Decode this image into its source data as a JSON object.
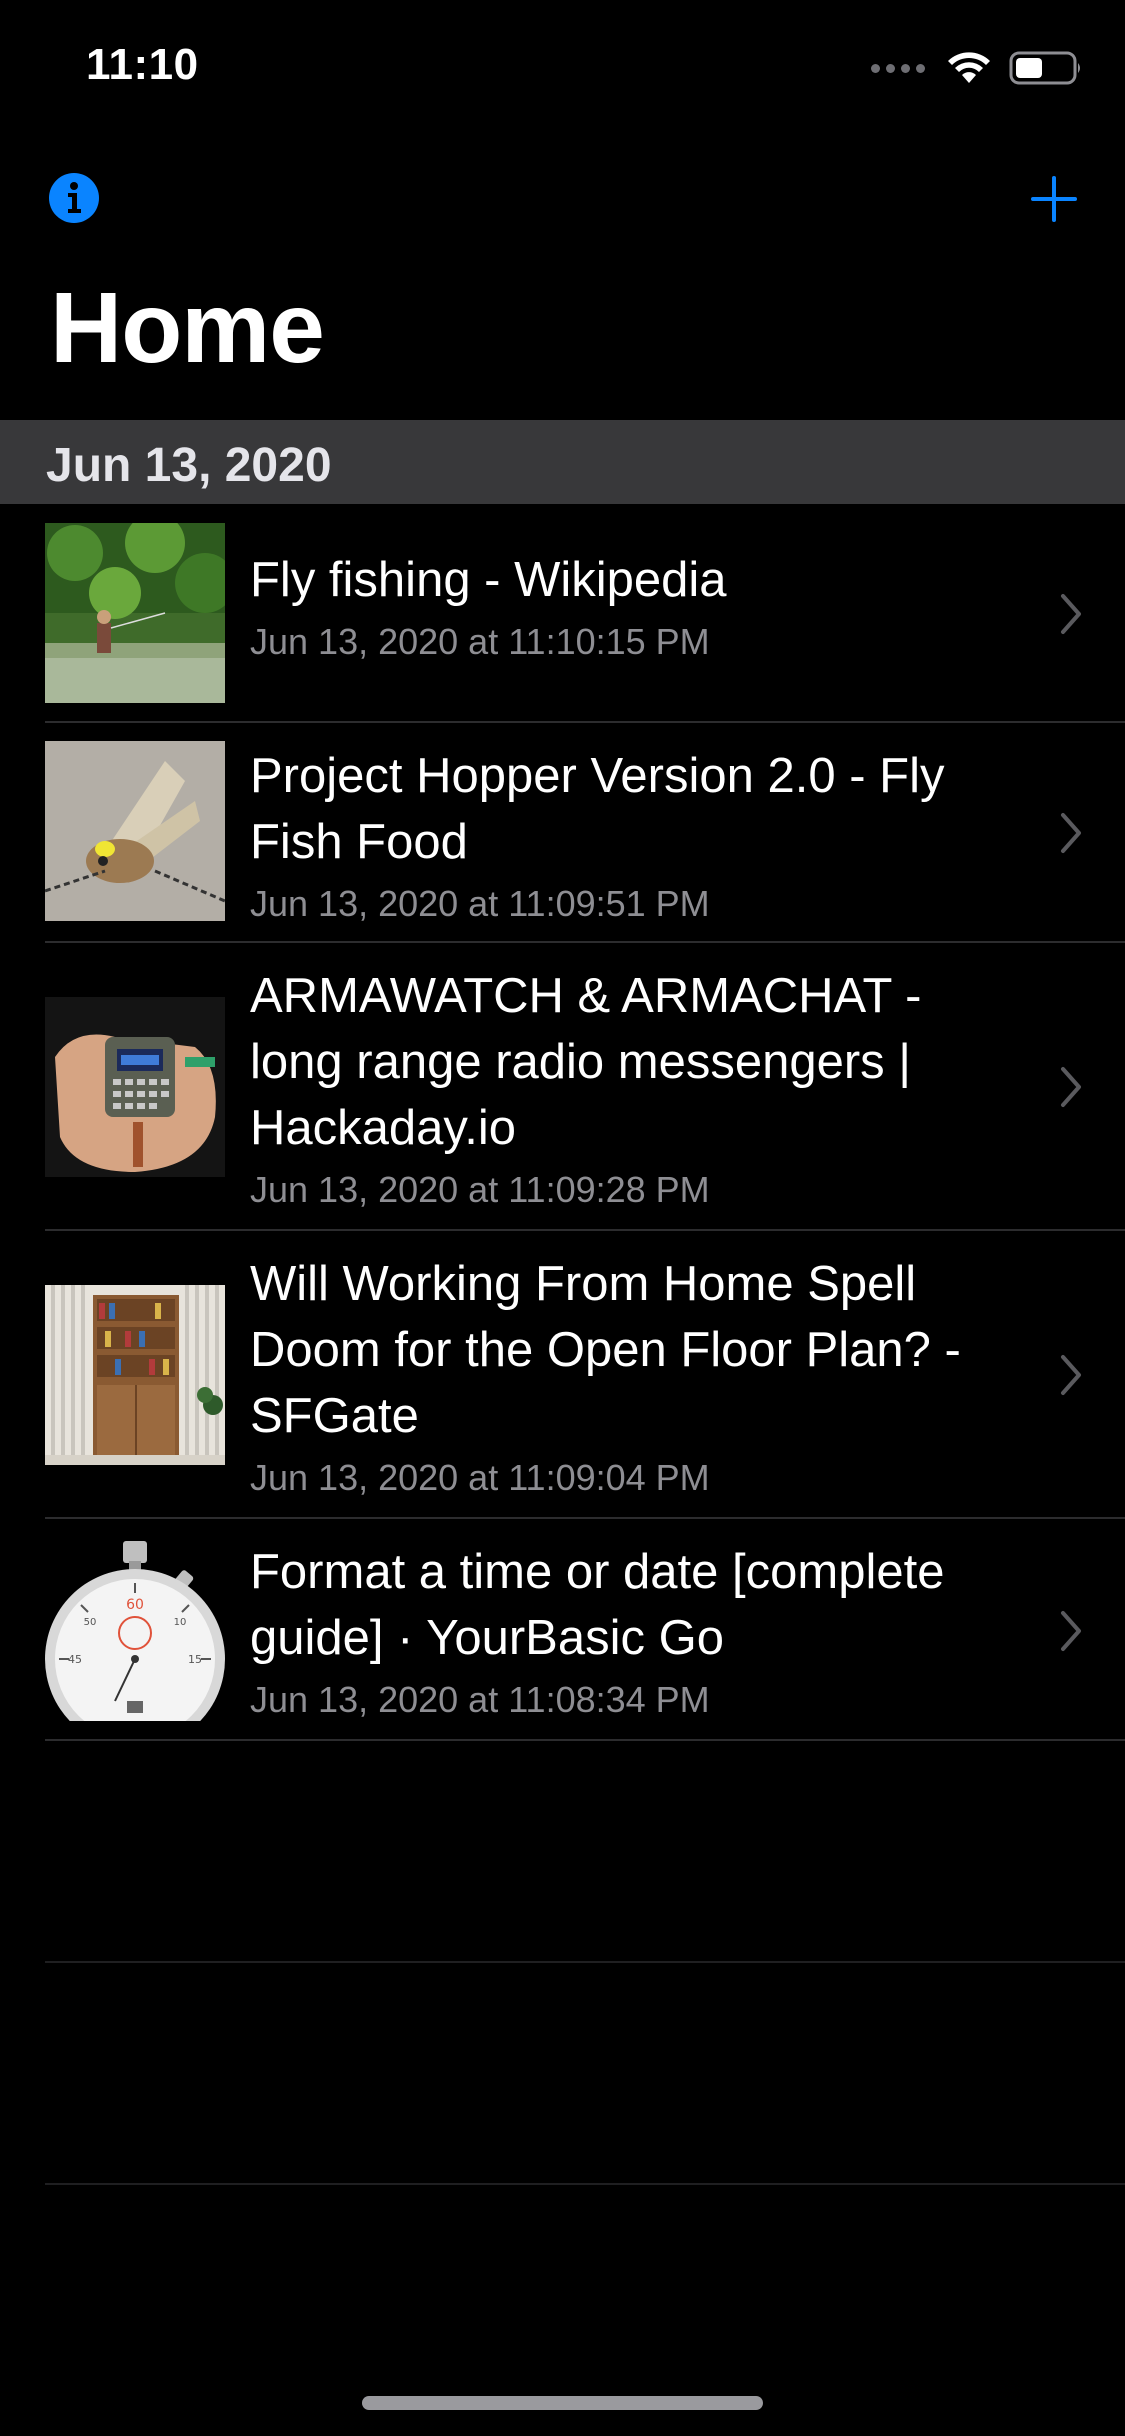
{
  "status_bar": {
    "time": "11:10",
    "battery_level": 0.45
  },
  "nav": {
    "title": "Home",
    "info_icon": "info-icon",
    "add_icon": "plus-icon",
    "accent_color": "#0a84ff"
  },
  "section": {
    "header": "Jun 13, 2020"
  },
  "items": [
    {
      "title": "Fly fishing - Wikipedia",
      "date": "Jun 13, 2020 at 11:10:15 PM",
      "thumbnail": "fly-fishing-river-photo"
    },
    {
      "title": "Project Hopper Version 2.0 - Fly Fish Food",
      "date": "Jun 13, 2020 at 11:09:51 PM",
      "thumbnail": "fly-lure-photo"
    },
    {
      "title": "ARMAWATCH & ARMACHAT - long range radio messengers | Hackaday.io",
      "date": "Jun 13, 2020 at 11:09:28 PM",
      "thumbnail": "hand-held-device-photo"
    },
    {
      "title": "Will Working From Home Spell Doom for the Open Floor Plan? - SFGate",
      "date": "Jun 13, 2020 at 11:09:04 PM",
      "thumbnail": "bookshelf-room-illustration"
    },
    {
      "title": "Format a time or date [complete guide] · YourBasic Go",
      "date": "Jun 13, 2020 at 11:08:34 PM",
      "thumbnail": "stopwatch-image"
    }
  ]
}
